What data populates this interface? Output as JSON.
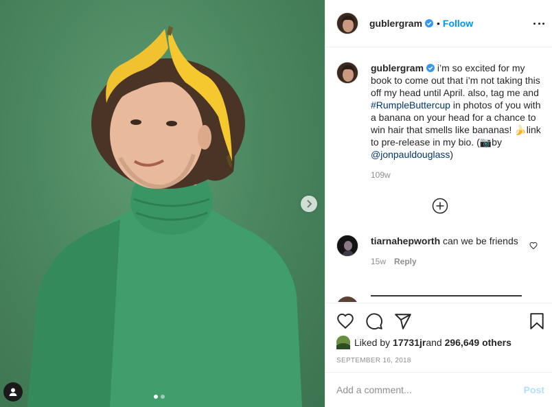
{
  "post": {
    "username": "gublergram",
    "follow_label": "Follow",
    "bullet": "•",
    "verified_icon": "verified-badge-icon",
    "more_icon": "more-options-icon",
    "accent_color": "#0095f6",
    "photo_slides": {
      "current": 1,
      "total": 2
    }
  },
  "caption": {
    "username": "gublergram",
    "text_a": "i’m so excited for my book to come out that i’m not taking this off my head until April. also, tag me and ",
    "hashtag": "#RumpleButtercup",
    "text_b": " in photos of you with a banana on your head for a chance to win hair that smells like bananas! 🍌link to pre-release in my bio. (📷by ",
    "mention": "@jonpauldouglass",
    "text_c": ")",
    "age": "109w"
  },
  "comment": {
    "username": "tiarnahepworth",
    "text": " can we be friends",
    "age": "15w",
    "reply_label": "Reply"
  },
  "actions": {
    "icons": [
      "heart-icon",
      "comment-icon",
      "share-icon",
      "bookmark-icon"
    ],
    "liked_by_prefix": "Liked by ",
    "liked_by_user": "17731jr",
    "liked_by_mid": " and ",
    "liked_by_others": "296,649 others",
    "date": "September 16, 2018"
  },
  "add_comment": {
    "placeholder": "Add a comment...",
    "post_label": "Post"
  }
}
